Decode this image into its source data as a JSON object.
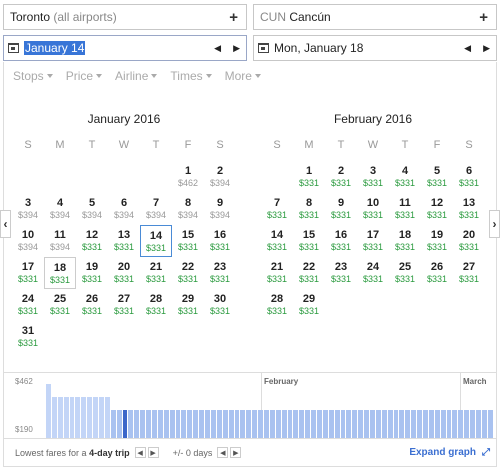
{
  "origin": {
    "city": "Toronto",
    "detail": "(all airports)"
  },
  "destination": {
    "code": "CUN",
    "city": "Cancún"
  },
  "departure": {
    "date": "January 14"
  },
  "return_date": {
    "date": "Mon, January 18"
  },
  "filters": [
    "Stops",
    "Price",
    "Airline",
    "Times",
    "More"
  ],
  "calendar": {
    "weekdays": [
      "S",
      "M",
      "T",
      "W",
      "T",
      "F",
      "S"
    ],
    "months": [
      {
        "title": "January 2016",
        "lead": 5,
        "days": [
          {
            "d": "1",
            "p": "$462",
            "c": "d"
          },
          {
            "d": "2",
            "p": "$394",
            "c": "d"
          },
          {
            "d": "3",
            "p": "$394",
            "c": "d"
          },
          {
            "d": "4",
            "p": "$394",
            "c": "d"
          },
          {
            "d": "5",
            "p": "$394",
            "c": "d"
          },
          {
            "d": "6",
            "p": "$394",
            "c": "d"
          },
          {
            "d": "7",
            "p": "$394",
            "c": "d"
          },
          {
            "d": "8",
            "p": "$394",
            "c": "d"
          },
          {
            "d": "9",
            "p": "$394",
            "c": "d"
          },
          {
            "d": "10",
            "p": "$394",
            "c": "d"
          },
          {
            "d": "11",
            "p": "$394",
            "c": "d"
          },
          {
            "d": "12",
            "p": "$331",
            "c": "g"
          },
          {
            "d": "13",
            "p": "$331",
            "c": "g"
          },
          {
            "d": "14",
            "p": "$331",
            "c": "g",
            "sel": true
          },
          {
            "d": "15",
            "p": "$331",
            "c": "g"
          },
          {
            "d": "16",
            "p": "$331",
            "c": "g"
          },
          {
            "d": "17",
            "p": "$331",
            "c": "g"
          },
          {
            "d": "18",
            "p": "$331",
            "c": "g",
            "ret": true
          },
          {
            "d": "19",
            "p": "$331",
            "c": "g"
          },
          {
            "d": "20",
            "p": "$331",
            "c": "g"
          },
          {
            "d": "21",
            "p": "$331",
            "c": "g"
          },
          {
            "d": "22",
            "p": "$331",
            "c": "g"
          },
          {
            "d": "23",
            "p": "$331",
            "c": "g"
          },
          {
            "d": "24",
            "p": "$331",
            "c": "g"
          },
          {
            "d": "25",
            "p": "$331",
            "c": "g"
          },
          {
            "d": "26",
            "p": "$331",
            "c": "g"
          },
          {
            "d": "27",
            "p": "$331",
            "c": "g"
          },
          {
            "d": "28",
            "p": "$331",
            "c": "g"
          },
          {
            "d": "29",
            "p": "$331",
            "c": "g"
          },
          {
            "d": "30",
            "p": "$331",
            "c": "g"
          },
          {
            "d": "31",
            "p": "$331",
            "c": "g"
          }
        ]
      },
      {
        "title": "February 2016",
        "lead": 1,
        "days": [
          {
            "d": "1",
            "p": "$331",
            "c": "g"
          },
          {
            "d": "2",
            "p": "$331",
            "c": "g"
          },
          {
            "d": "3",
            "p": "$331",
            "c": "g"
          },
          {
            "d": "4",
            "p": "$331",
            "c": "g"
          },
          {
            "d": "5",
            "p": "$331",
            "c": "g"
          },
          {
            "d": "6",
            "p": "$331",
            "c": "g"
          },
          {
            "d": "7",
            "p": "$331",
            "c": "g"
          },
          {
            "d": "8",
            "p": "$331",
            "c": "g"
          },
          {
            "d": "9",
            "p": "$331",
            "c": "g"
          },
          {
            "d": "10",
            "p": "$331",
            "c": "g"
          },
          {
            "d": "11",
            "p": "$331",
            "c": "g"
          },
          {
            "d": "12",
            "p": "$331",
            "c": "g"
          },
          {
            "d": "13",
            "p": "$331",
            "c": "g"
          },
          {
            "d": "14",
            "p": "$331",
            "c": "g"
          },
          {
            "d": "15",
            "p": "$331",
            "c": "g"
          },
          {
            "d": "16",
            "p": "$331",
            "c": "g"
          },
          {
            "d": "17",
            "p": "$331",
            "c": "g"
          },
          {
            "d": "18",
            "p": "$331",
            "c": "g"
          },
          {
            "d": "19",
            "p": "$331",
            "c": "g"
          },
          {
            "d": "20",
            "p": "$331",
            "c": "g"
          },
          {
            "d": "21",
            "p": "$331",
            "c": "g"
          },
          {
            "d": "22",
            "p": "$331",
            "c": "g"
          },
          {
            "d": "23",
            "p": "$331",
            "c": "g"
          },
          {
            "d": "24",
            "p": "$331",
            "c": "g"
          },
          {
            "d": "25",
            "p": "$331",
            "c": "g"
          },
          {
            "d": "26",
            "p": "$331",
            "c": "g"
          },
          {
            "d": "27",
            "p": "$331",
            "c": "g"
          },
          {
            "d": "28",
            "p": "$331",
            "c": "g"
          },
          {
            "d": "29",
            "p": "$331",
            "c": "g"
          }
        ]
      }
    ]
  },
  "graph": {
    "y_max": "$462",
    "y_min": "$190",
    "month_labels": [
      "February",
      "March"
    ],
    "bars": [
      462,
      394,
      394,
      394,
      394,
      394,
      394,
      394,
      394,
      394,
      394,
      331,
      331,
      331,
      331,
      331,
      331,
      331,
      331,
      331,
      331,
      331,
      331,
      331,
      331,
      331,
      331,
      331,
      331,
      331,
      331,
      331,
      331,
      331,
      331,
      331,
      331,
      331,
      331,
      331,
      331,
      331,
      331,
      331,
      331,
      331,
      331,
      331,
      331,
      331,
      331,
      331,
      331,
      331,
      331,
      331,
      331,
      331,
      331,
      331,
      331,
      331,
      331,
      331,
      331,
      331,
      331,
      331,
      331,
      331,
      331,
      331,
      331,
      331,
      331,
      331
    ],
    "selected_index": 13
  },
  "footer": {
    "label": "Lowest fares for a",
    "trip": "4-day trip",
    "flex": "+/- 0 days",
    "expand": "Expand graph"
  },
  "colors": {
    "green": "#2a9a3e",
    "accent": "#3b6fd1",
    "bar": "#c3d5f7",
    "bar_selected": "#3b66c9"
  }
}
